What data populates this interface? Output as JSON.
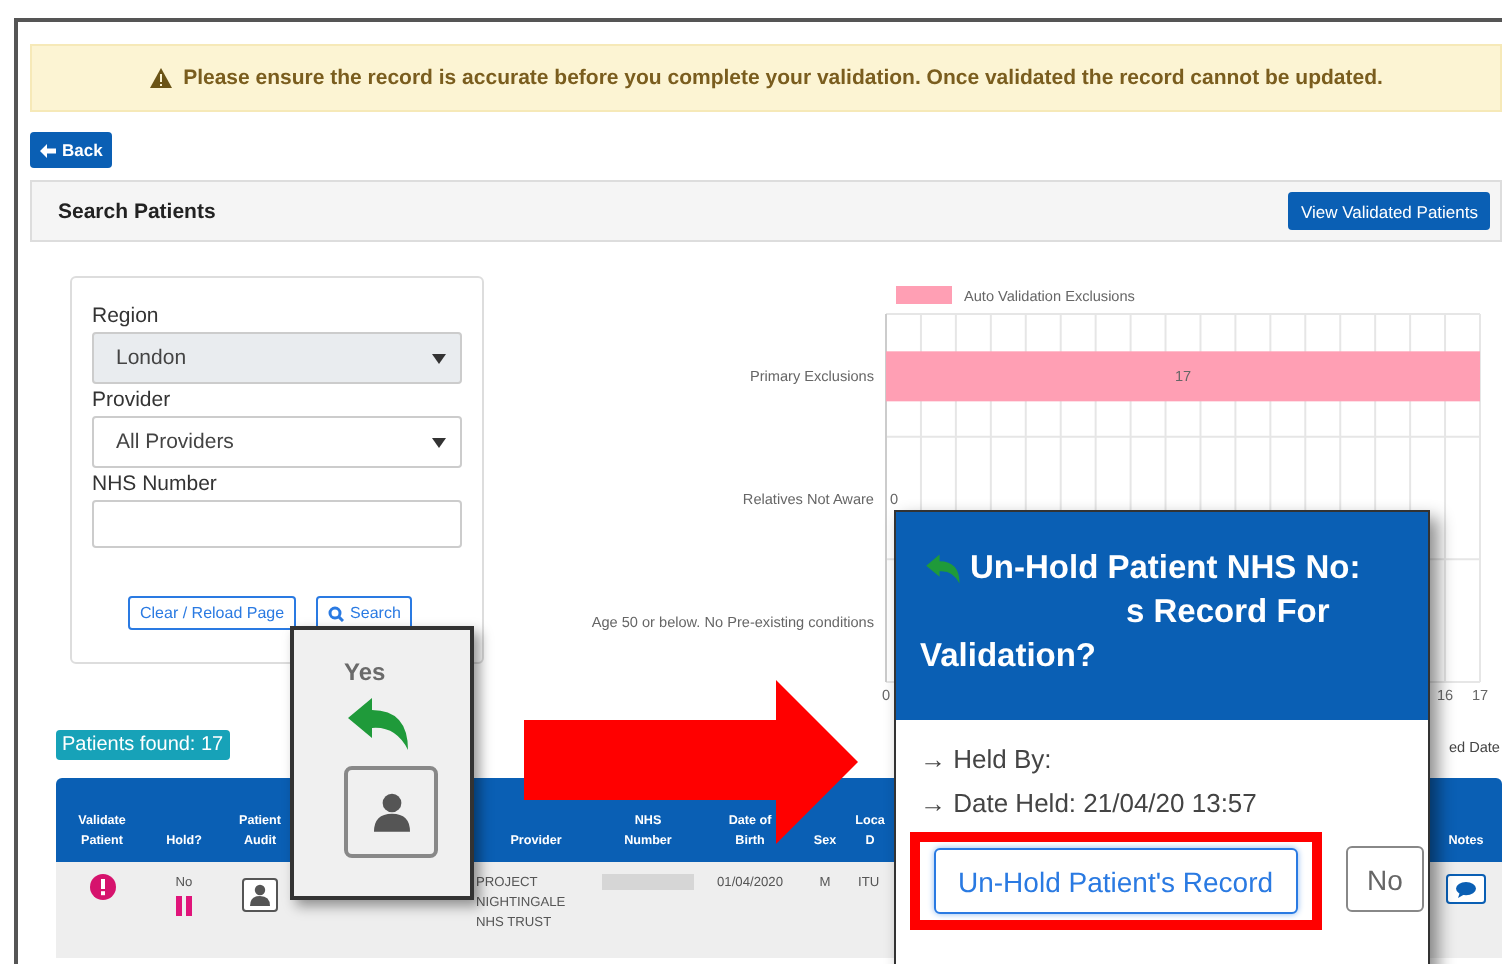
{
  "alert": {
    "text": "Please ensure the record is accurate before you complete your validation. Once validated the record cannot be updated."
  },
  "back_button": {
    "label": "Back"
  },
  "panel": {
    "title": "Search Patients",
    "action_button": "View Validated Patients"
  },
  "search_form": {
    "fields": [
      {
        "kind": "select",
        "label": "Region",
        "value": "London",
        "disabled": true
      },
      {
        "kind": "select",
        "label": "Provider",
        "value": "All Providers",
        "disabled": false
      },
      {
        "kind": "text",
        "label": "NHS Number"
      }
    ],
    "buttons": [
      {
        "kind": "plain",
        "label": "Clear / Reload Page"
      },
      {
        "kind": "search",
        "label": "Search"
      }
    ]
  },
  "chart": {
    "chart_data": {
      "type": "bar",
      "orientation": "horizontal",
      "categories": [
        "Primary Exclusions",
        "Relatives Not Aware",
        "Age 50 or below. No Pre-existing conditions"
      ],
      "series": [
        {
          "name": "Auto Validation Exclusions",
          "color": "#ff9fb4",
          "values": [
            17,
            0,
            null
          ]
        }
      ],
      "xlim": [
        0,
        17
      ],
      "xticks": [
        0,
        16,
        17
      ],
      "data_labels": true
    },
    "axis_label_fragment": "ed Date"
  },
  "patients_found": "Patients found: 17",
  "table": {
    "columns": [
      "Validate Patient",
      "Hold?",
      "Patient Audit",
      "",
      "Provider",
      "NHS Number",
      "Date of Birth",
      "Sex",
      "Loca D",
      "",
      "Notes"
    ],
    "rows": [
      {
        "validated": false,
        "hold": "No",
        "on_hold": true,
        "provider": "PROJECT NIGHTINGALE NHS TRUST",
        "date_of_birth": "01/04/2020",
        "sex": "M",
        "location": "ITU"
      }
    ]
  },
  "zoom_inset": {
    "label": "Yes"
  },
  "dialog": {
    "title_start": "Un-Hold Patient NHS No:",
    "title_end": "s Record For Validation?",
    "held_by": "→ Held By:",
    "date_held": "→ Date Held: 21/04/20 13:57",
    "buttons": [
      {
        "label": "Un-Hold Patient's Record",
        "highlighted": true
      },
      {
        "label": "No",
        "highlighted": false
      }
    ]
  }
}
